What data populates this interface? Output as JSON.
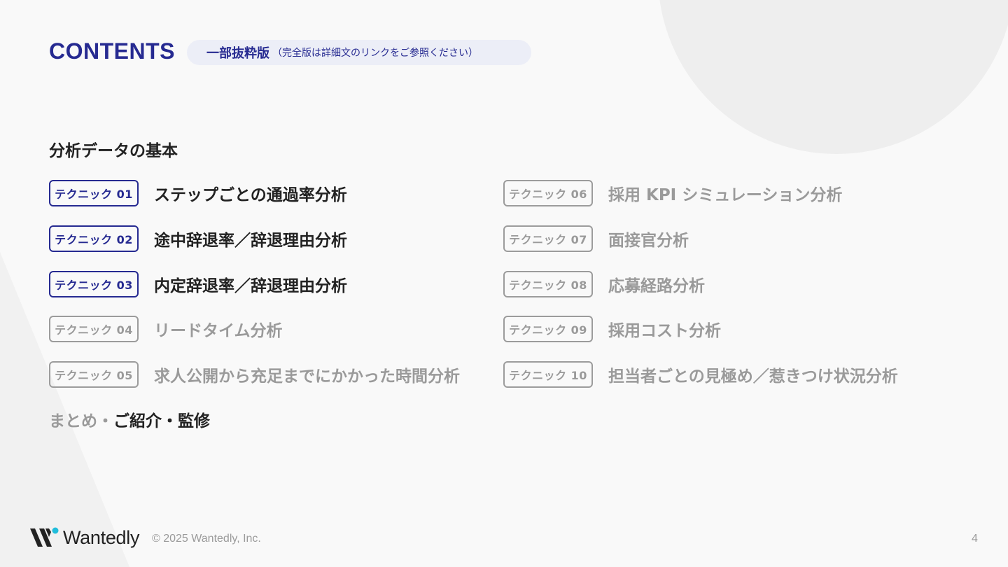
{
  "header": {
    "title": "CONTENTS",
    "pill_main": "一部抜粋版",
    "pill_note": "（完全版は詳細文のリンクをご参照ください）"
  },
  "section": {
    "title": "分析データの基本"
  },
  "techniques": [
    {
      "badge": "テクニック 01",
      "title": "ステップごとの通過率分析",
      "active": true
    },
    {
      "badge": "テクニック 02",
      "title": "途中辞退率／辞退理由分析",
      "active": true
    },
    {
      "badge": "テクニック 03",
      "title": "内定辞退率／辞退理由分析",
      "active": true
    },
    {
      "badge": "テクニック 04",
      "title": "リードタイム分析",
      "active": false
    },
    {
      "badge": "テクニック 05",
      "title": "求人公開から充足までにかかった時間分析",
      "active": false
    },
    {
      "badge": "テクニック 06",
      "title": "採用 KPI シミュレーション分析",
      "active": false
    },
    {
      "badge": "テクニック 07",
      "title": "面接官分析",
      "active": false
    },
    {
      "badge": "テクニック 08",
      "title": "応募経路分析",
      "active": false
    },
    {
      "badge": "テクニック 09",
      "title": "採用コスト分析",
      "active": false
    },
    {
      "badge": "テクニック 10",
      "title": "担当者ごとの見極め／惹きつけ状況分析",
      "active": false
    }
  ],
  "summary": {
    "muted": "まとめ・",
    "strong": "ご紹介・監修"
  },
  "footer": {
    "logo_text": "Wantedly",
    "copyright": "© 2025 Wantedly, Inc.",
    "page_number": "4"
  },
  "colors": {
    "accent": "#262a91",
    "logo_dot": "#21bddb",
    "text_dark": "#222222",
    "text_muted": "#9a9a9a",
    "background": "#f9f9f9"
  }
}
